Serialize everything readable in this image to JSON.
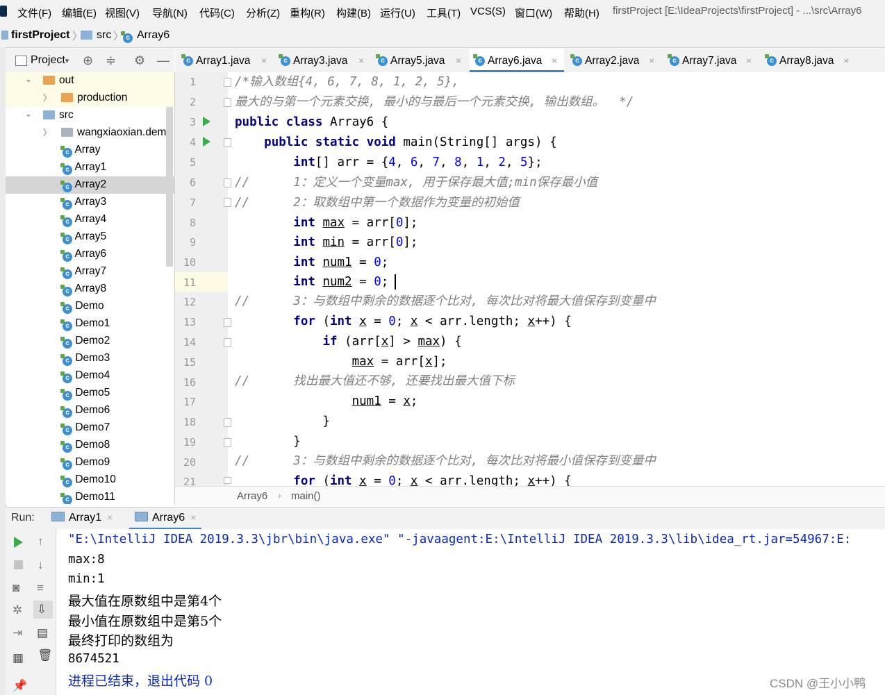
{
  "menu": {
    "items": [
      "文件(F)",
      "编辑(E)",
      "视图(V)",
      "导航(N)",
      "代码(C)",
      "分析(Z)",
      "重构(R)",
      "构建(B)",
      "运行(U)",
      "工具(T)",
      "VCS(S)",
      "窗口(W)",
      "帮助(H)"
    ],
    "window_title": "firstProject [E:\\IdeaProjects\\firstProject] - ...\\src\\Array6"
  },
  "navbar": {
    "project": "firstProject",
    "folder": "src",
    "file": "Array6"
  },
  "project_panel": {
    "title": "Project",
    "tree": [
      {
        "label": "out",
        "type": "folder-orange",
        "arrow": "v"
      },
      {
        "label": "production",
        "type": "folder-orange",
        "arrow": ">"
      },
      {
        "label": "src",
        "type": "folder-blue",
        "arrow": "v"
      },
      {
        "label": "wangxiaoxian.demo",
        "type": "package",
        "arrow": ">"
      },
      {
        "label": "Array",
        "type": "class"
      },
      {
        "label": "Array1",
        "type": "class"
      },
      {
        "label": "Array2",
        "type": "class"
      },
      {
        "label": "Array3",
        "type": "class"
      },
      {
        "label": "Array4",
        "type": "class"
      },
      {
        "label": "Array5",
        "type": "class"
      },
      {
        "label": "Array6",
        "type": "class"
      },
      {
        "label": "Array7",
        "type": "class"
      },
      {
        "label": "Array8",
        "type": "class"
      },
      {
        "label": "Demo",
        "type": "class"
      },
      {
        "label": "Demo1",
        "type": "class"
      },
      {
        "label": "Demo2",
        "type": "class"
      },
      {
        "label": "Demo3",
        "type": "class"
      },
      {
        "label": "Demo4",
        "type": "class"
      },
      {
        "label": "Demo5",
        "type": "class"
      },
      {
        "label": "Demo6",
        "type": "class"
      },
      {
        "label": "Demo7",
        "type": "class"
      },
      {
        "label": "Demo8",
        "type": "class"
      },
      {
        "label": "Demo9",
        "type": "class"
      },
      {
        "label": "Demo10",
        "type": "class"
      },
      {
        "label": "Demo11",
        "type": "class"
      }
    ]
  },
  "tabs": [
    {
      "label": "Array1.java",
      "active": false
    },
    {
      "label": "Array3.java",
      "active": false
    },
    {
      "label": "Array5.java",
      "active": false
    },
    {
      "label": "Array6.java",
      "active": true
    },
    {
      "label": "Array2.java",
      "active": false
    },
    {
      "label": "Array7.java",
      "active": false
    },
    {
      "label": "Array8.java",
      "active": false
    }
  ],
  "editor": {
    "line_numbers": [
      "1",
      "2",
      "3",
      "4",
      "5",
      "6",
      "7",
      "8",
      "9",
      "10",
      "11",
      "12",
      "13",
      "14",
      "15",
      "16",
      "17",
      "18",
      "19",
      "20",
      "21"
    ],
    "current_line": "11"
  },
  "breadcrumb": {
    "class": "Array6",
    "method": "main()"
  },
  "run": {
    "label": "Run:",
    "tabs": [
      "Array1",
      "Array6"
    ],
    "output": [
      "\"E:\\IntelliJ IDEA 2019.3.3\\jbr\\bin\\java.exe\" \"-javaagent:E:\\IntelliJ IDEA 2019.3.3\\lib\\idea_rt.jar=54967:E:",
      "max:8",
      "min:1",
      "最大值在原数组中是第4个",
      "最小值在原数组中是第5个",
      "最终打印的数组为",
      "8674521",
      "进程已结束，退出代码 0"
    ]
  },
  "watermark": "CSDN @王小小鸭",
  "colors": {
    "keyword": "#000080",
    "number": "#0000ff",
    "comment": "#808080",
    "accent": "#4083c9",
    "run_green": "#3daa4c"
  }
}
